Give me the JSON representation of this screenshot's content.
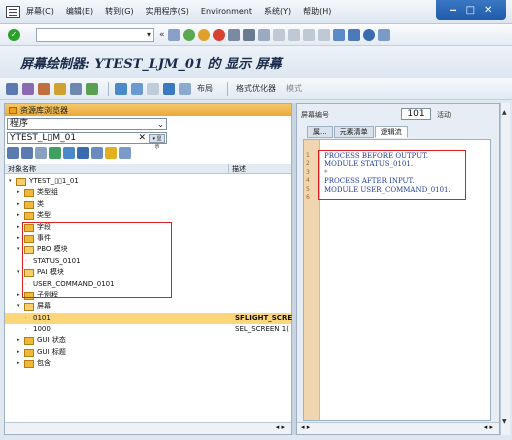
{
  "menu": [
    "屏幕(C)",
    "编辑(E)",
    "转到(G)",
    "实用程序(S)",
    "Environment",
    "系统(Y)",
    "帮助(H)"
  ],
  "title": "屏幕绘制器: YTEST_LJM_01 的 显示 屏幕",
  "apptoolbar": {
    "layout": "布局",
    "attributes": "格式优化器",
    "mode": "模式"
  },
  "left": {
    "header": "资源库浏览器",
    "object_type": "程序",
    "object_name": "YTEST_L▯M_01",
    "col_name": "对象名称",
    "col_desc": "描述",
    "tree": [
      {
        "label": "YTEST_▯▯1_01",
        "level": 0,
        "open": true,
        "desc": ""
      },
      {
        "label": "类型组",
        "level": 1,
        "desc": ""
      },
      {
        "label": "类",
        "level": 1,
        "desc": ""
      },
      {
        "label": "类型",
        "level": 1,
        "desc": ""
      },
      {
        "label": "字段",
        "level": 1,
        "desc": ""
      },
      {
        "label": "事件",
        "level": 1,
        "desc": ""
      },
      {
        "label": "PBO 模块",
        "level": 1,
        "open": true,
        "desc": ""
      },
      {
        "label": "STATUS_0101",
        "level": 2,
        "leaf": true,
        "desc": ""
      },
      {
        "label": "PAI 模块",
        "level": 1,
        "open": true,
        "desc": ""
      },
      {
        "label": "USER_COMMAND_0101",
        "level": 2,
        "leaf": true,
        "desc": ""
      },
      {
        "label": "子例程",
        "level": 1,
        "desc": ""
      },
      {
        "label": "屏幕",
        "level": 1,
        "open": true,
        "desc": ""
      },
      {
        "label": "0101",
        "level": 2,
        "leaf": true,
        "selected": true,
        "desc": "SFLIGHT_SCRE"
      },
      {
        "label": "1000",
        "level": 2,
        "leaf": true,
        "desc": "SEL_SCREEN 1("
      },
      {
        "label": "GUI 状态",
        "level": 1,
        "desc": ""
      },
      {
        "label": "GUI 标题",
        "level": 1,
        "desc": ""
      },
      {
        "label": "包含",
        "level": 1,
        "desc": ""
      }
    ]
  },
  "right": {
    "screen_label": "屏幕编号",
    "screen_number": "101",
    "status": "活动",
    "tabs": [
      "属...",
      "元素清单",
      "逻辑流"
    ],
    "code_lines": [
      "PROCESS BEFORE OUTPUT.",
      " MODULE STATUS_0101.",
      "*",
      "PROCESS AFTER INPUT.",
      " MODULE USER_COMMAND_0101."
    ]
  }
}
